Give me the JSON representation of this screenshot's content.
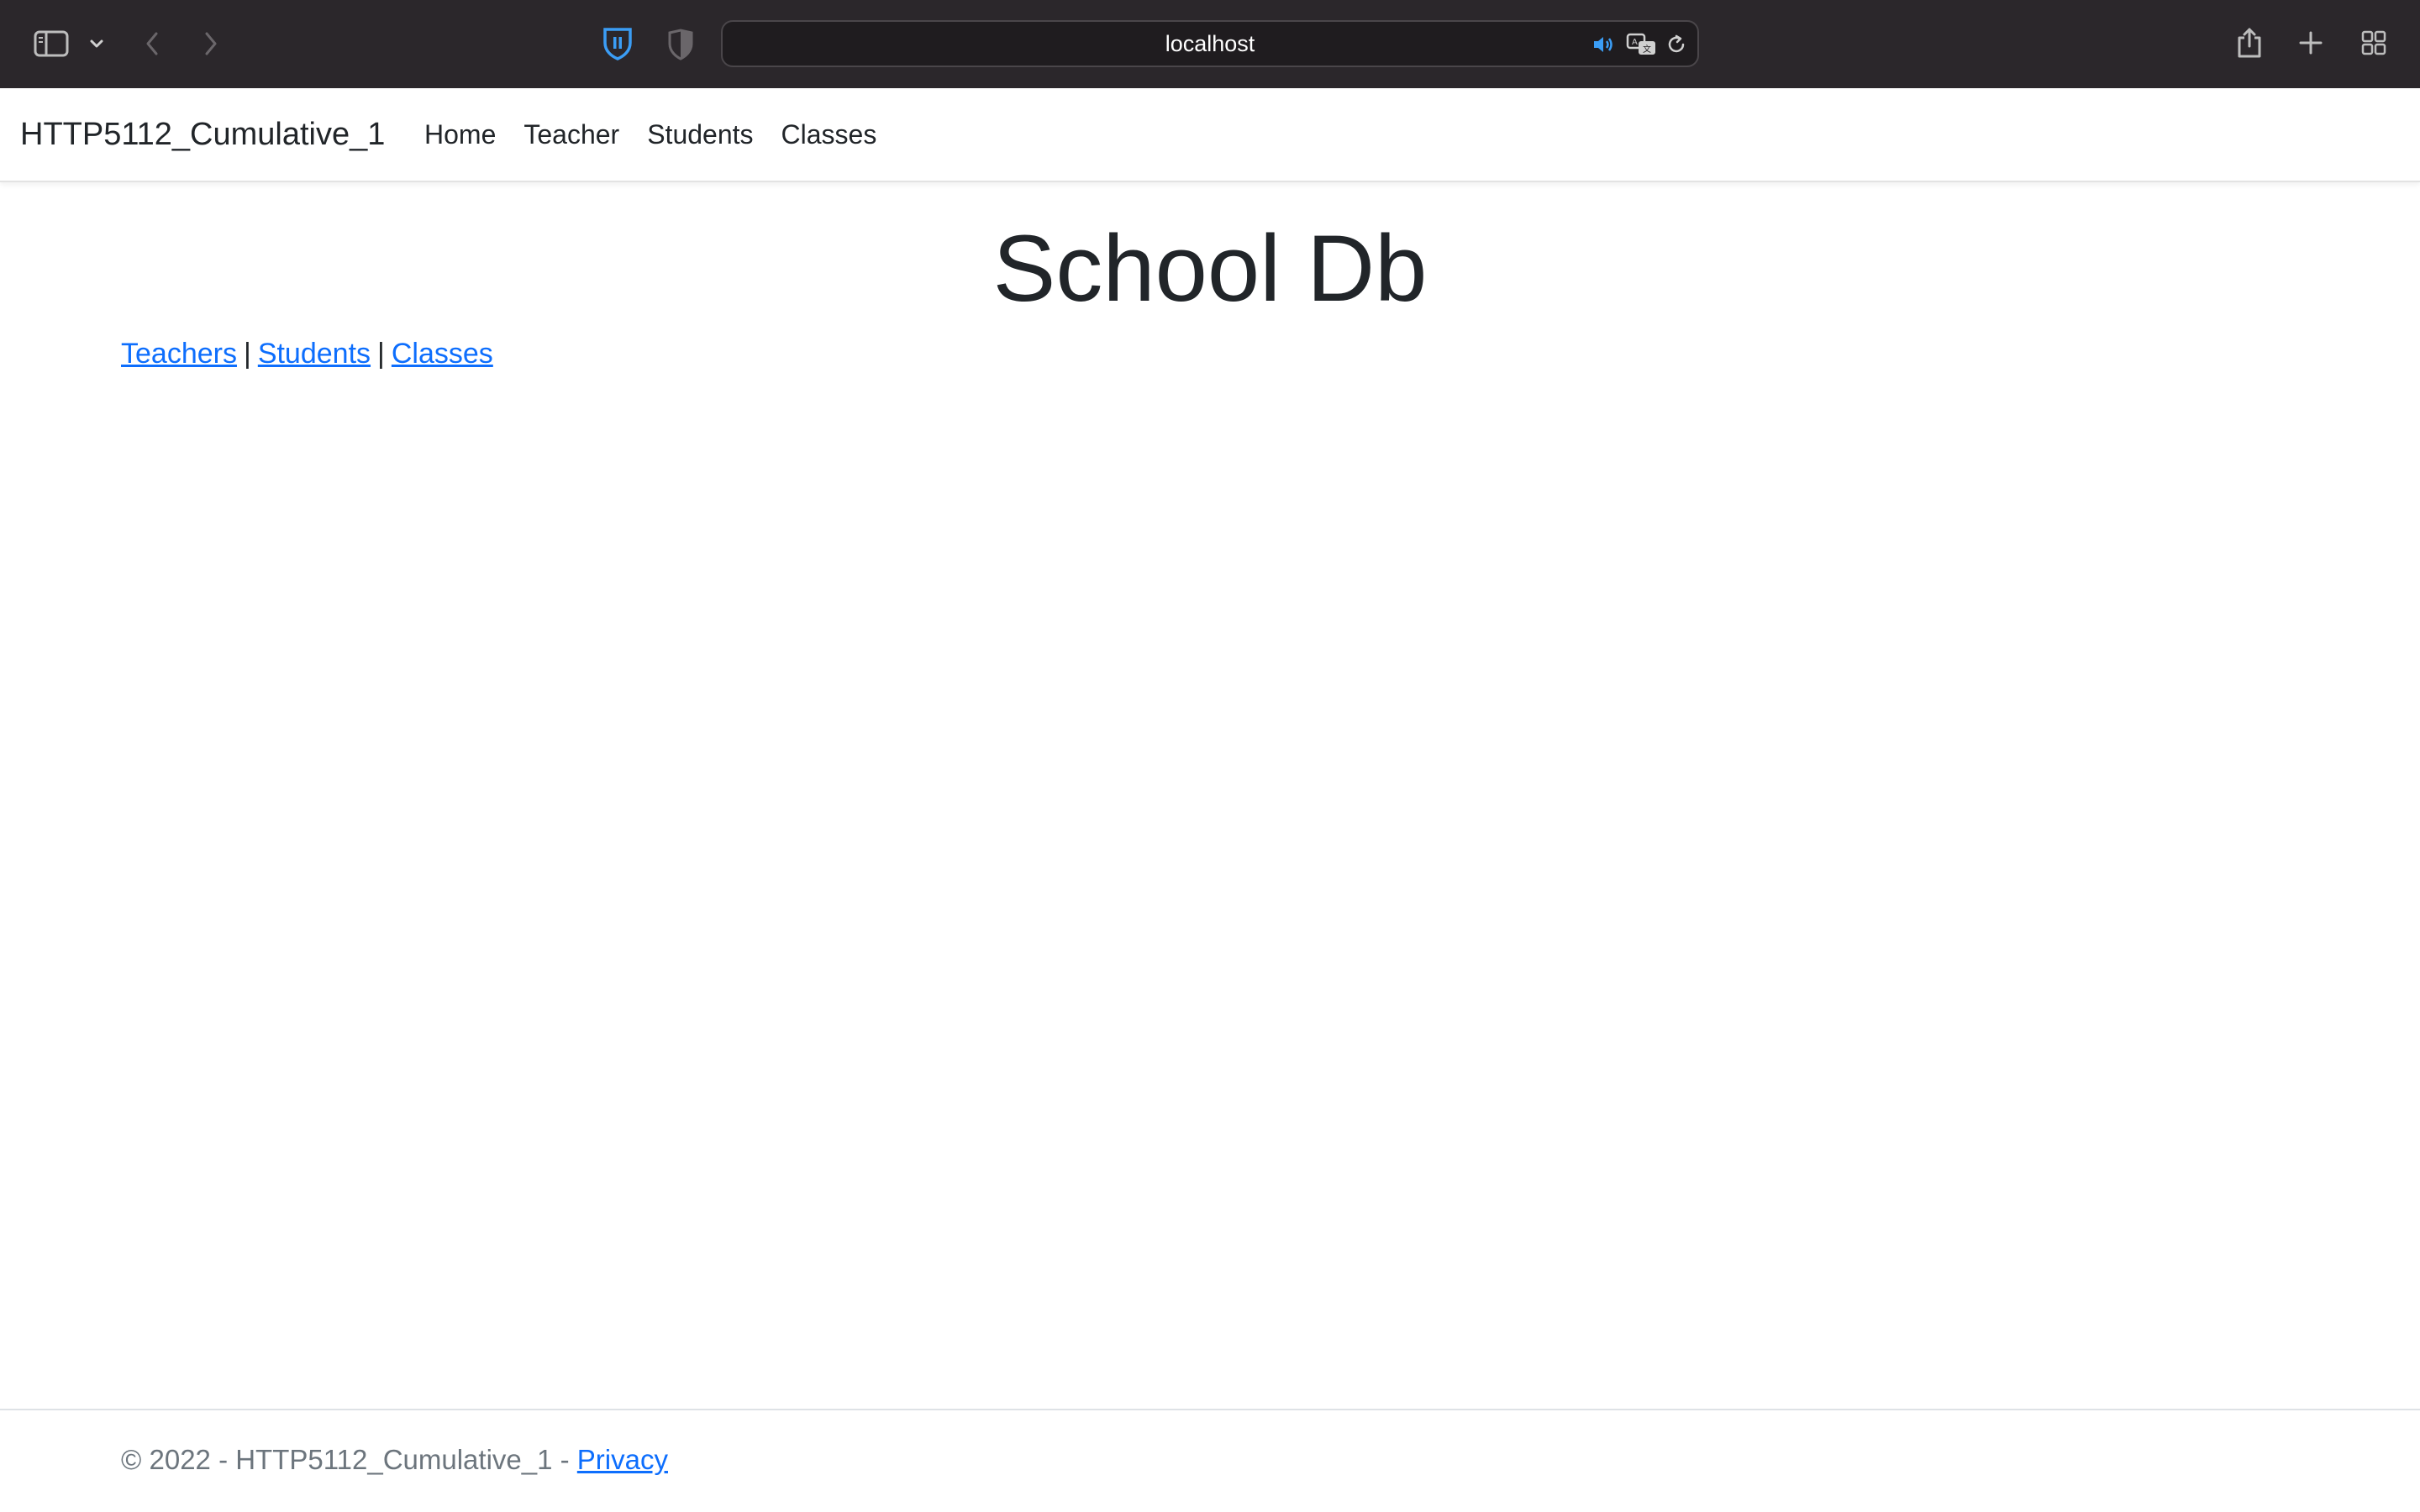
{
  "browser": {
    "url": "localhost"
  },
  "navbar": {
    "brand": "HTTP5112_Cumulative_1",
    "links": [
      {
        "label": "Home"
      },
      {
        "label": "Teacher"
      },
      {
        "label": "Students"
      },
      {
        "label": "Classes"
      }
    ]
  },
  "main": {
    "title": "School Db",
    "links": [
      {
        "label": "Teachers"
      },
      {
        "label": "Students"
      },
      {
        "label": "Classes"
      }
    ],
    "separator": "|"
  },
  "footer": {
    "text": "© 2022 - HTTP5112_Cumulative_1 - ",
    "privacy_label": "Privacy"
  },
  "colors": {
    "chrome_bg": "#2b272b",
    "link": "#0d6efd",
    "shield_accent": "#3b9df5"
  }
}
